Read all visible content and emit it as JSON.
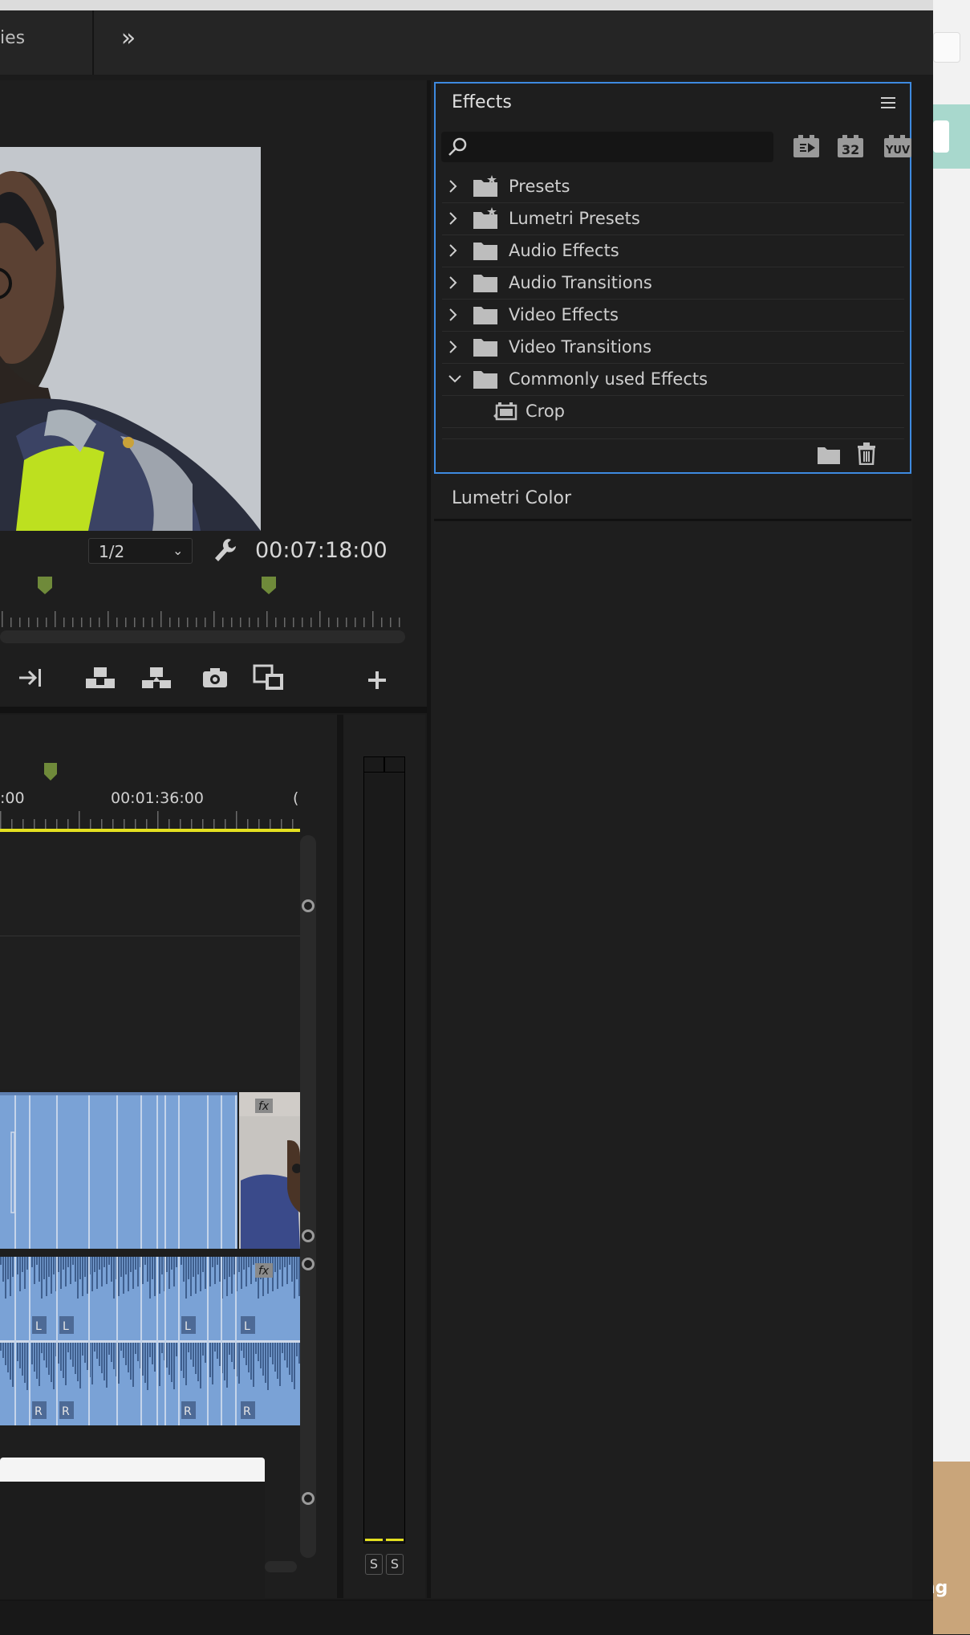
{
  "header": {
    "tab_partial": "ies",
    "overflow_glyph": "»"
  },
  "monitor": {
    "resolution": "1/2",
    "timecode": "00:07:18:00"
  },
  "timeline": {
    "time_a": ":00",
    "time_b": "00:01:36:00",
    "time_c": "("
  },
  "audio_meter": {
    "solo_left": "S",
    "solo_right": "S"
  },
  "effects": {
    "title": "Effects",
    "search_value": "",
    "buttons": [
      "accelerated-effects-icon",
      "32-bit-icon",
      "yuv-icon"
    ],
    "btn_32": "32",
    "btn_yuv": "YUV",
    "tree": [
      {
        "label": "Presets",
        "expanded": false
      },
      {
        "label": "Lumetri Presets",
        "expanded": false
      },
      {
        "label": "Audio Effects",
        "expanded": false
      },
      {
        "label": "Audio Transitions",
        "expanded": false
      },
      {
        "label": "Video Effects",
        "expanded": false
      },
      {
        "label": "Video Transitions",
        "expanded": false
      },
      {
        "label": "Commonly used Effects",
        "expanded": true
      }
    ],
    "child_item": "Crop"
  },
  "lumetri": {
    "title": "Lumetri Color"
  },
  "outside": {
    "partial_text": "ng"
  },
  "clip_labels": {
    "fx": "fx",
    "left": "L",
    "right": "R"
  },
  "colors": {
    "accent_blue": "#3e8ae0",
    "playhead_yellow": "#e4e020",
    "clip_blue": "#7aa2d6",
    "marker_green": "#6f8a3a"
  }
}
